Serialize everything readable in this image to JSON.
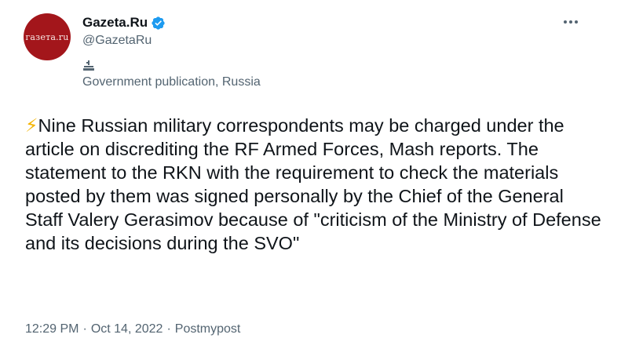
{
  "author": {
    "avatar_text": "газета.ru",
    "display_name": "Gazeta.Ru",
    "handle": "@GazetaRu",
    "verified": true,
    "label_icon": "government-building-icon",
    "label": "Government publication, Russia"
  },
  "menu": {
    "icon": "more-horizontal-icon"
  },
  "tweet": {
    "emoji": "⚡",
    "text": "Nine Russian military correspondents may be charged under the article on discrediting the RF Armed Forces, Mash reports. The statement to the RKN with the requirement to check the materials posted by them was signed personally by the Chief of the General Staff Valery Gerasimov because of \"criticism of the Ministry of Defense and its decisions during the SVO\""
  },
  "meta": {
    "time": "12:29 PM",
    "separator": "·",
    "date": "Oct 14, 2022",
    "source": "Postmypost"
  },
  "colors": {
    "avatar_bg": "#a3161b",
    "verified": "#1d9bf0",
    "secondary_text": "#536471",
    "primary_text": "#0f1419"
  }
}
